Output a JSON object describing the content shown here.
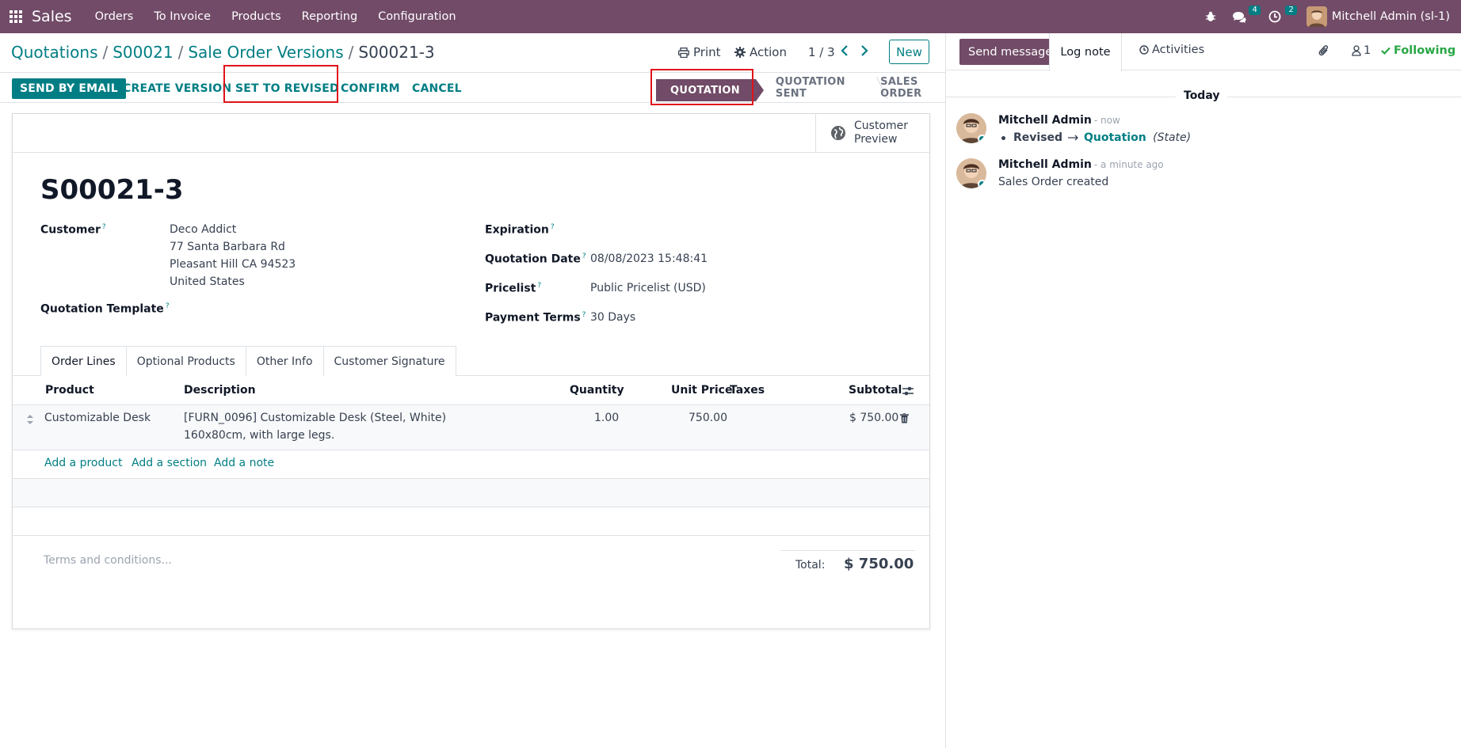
{
  "navbar": {
    "app_name": "Sales",
    "menu": [
      "Orders",
      "To Invoice",
      "Products",
      "Reporting",
      "Configuration"
    ],
    "messages_badge": "4",
    "activities_badge": "2",
    "user_name": "Mitchell Admin (sl-1)",
    "brand_color": "#714B67"
  },
  "breadcrumb": {
    "items": [
      "Quotations",
      "S00021",
      "Sale Order Versions"
    ],
    "current": "S00021-3"
  },
  "control": {
    "print_label": "Print",
    "action_label": "Action",
    "pager": "1 / 3",
    "new_label": "New"
  },
  "actions": {
    "send_email": "SEND BY EMAIL",
    "create_version": "CREATE VERSION",
    "set_revised": "SET TO REVISED",
    "confirm": "CONFIRM",
    "cancel": "CANCEL"
  },
  "status": {
    "stages": [
      "QUOTATION",
      "QUOTATION SENT",
      "SALES ORDER"
    ],
    "active": "QUOTATION"
  },
  "form": {
    "customer_preview": [
      "Customer",
      "Preview"
    ],
    "title": "S00021-3",
    "customer_label": "Customer",
    "customer_lines": [
      "Deco Addict",
      "77 Santa Barbara Rd",
      "Pleasant Hill CA 94523",
      "United States"
    ],
    "template_label": "Quotation Template",
    "expiration_label": "Expiration",
    "quotation_date_label": "Quotation Date",
    "quotation_date": "08/08/2023 15:48:41",
    "pricelist_label": "Pricelist",
    "pricelist": "Public Pricelist (USD)",
    "payment_terms_label": "Payment Terms",
    "payment_terms": "30 Days",
    "help_mark": "?"
  },
  "tabs": [
    "Order Lines",
    "Optional Products",
    "Other Info",
    "Customer Signature"
  ],
  "table": {
    "headers": {
      "product": "Product",
      "description": "Description",
      "quantity": "Quantity",
      "unit_price": "Unit Price",
      "taxes": "Taxes",
      "subtotal": "Subtotal"
    },
    "rows": [
      {
        "product": "Customizable Desk",
        "description_1": "[FURN_0096] Customizable Desk (Steel, White)",
        "description_2": "160x80cm, with large legs.",
        "quantity": "1.00",
        "unit_price": "750.00",
        "taxes": "",
        "subtotal": "$ 750.00"
      }
    ],
    "add_product": "Add a product",
    "add_section": "Add a section",
    "add_note": "Add a note"
  },
  "footer": {
    "terms_placeholder": "Terms and conditions...",
    "total_label": "Total:",
    "total_value": "$ 750.00"
  },
  "chatter": {
    "send_message": "Send message",
    "log_note": "Log note",
    "activities": "Activities",
    "followers_count": "1",
    "following": "Following",
    "today": "Today",
    "messages": [
      {
        "author": "Mitchell Admin",
        "time": "- now",
        "change_old": "Revised",
        "change_new": "Quotation",
        "change_field": "(State)"
      },
      {
        "author": "Mitchell Admin",
        "time": "- a minute ago",
        "body": "Sales Order created"
      }
    ]
  }
}
